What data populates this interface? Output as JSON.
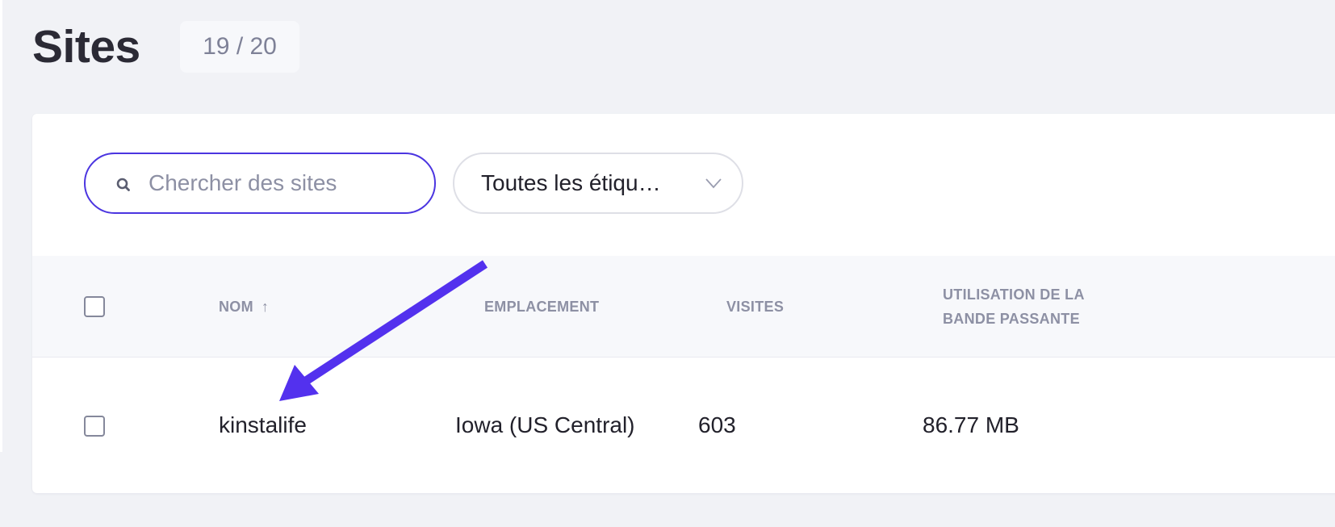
{
  "header": {
    "title": "Sites",
    "count": "19 / 20"
  },
  "filters": {
    "search_placeholder": "Chercher des sites",
    "search_value": "",
    "tag_selected": "Toutes les étiqu…"
  },
  "table": {
    "columns": [
      "NOM",
      "EMPLACEMENT",
      "VISITES",
      "UTILISATION DE LA BANDE PASSANTE"
    ],
    "sort_indicator": "↑",
    "rows": [
      {
        "name": "kinstalife",
        "location": "Iowa (US Central)",
        "visits": "603",
        "bandwidth": "86.77 MB"
      }
    ]
  },
  "colors": {
    "accent": "#4b35e0",
    "annotation_arrow": "#5331ee",
    "background": "#f1f2f6",
    "muted_text": "#8d90a4"
  },
  "icons": {
    "search": "search-icon",
    "dropdown": "chevron-down-icon",
    "annotation": "annotation-arrow"
  }
}
